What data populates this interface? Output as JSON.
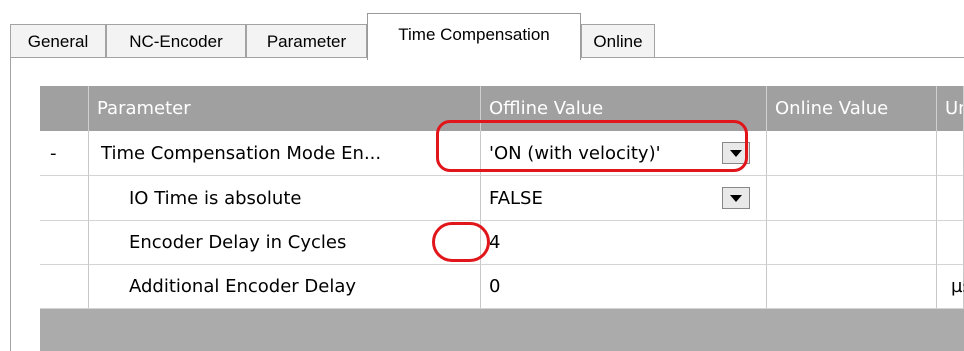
{
  "tabs": [
    {
      "label": "General"
    },
    {
      "label": "NC-Encoder"
    },
    {
      "label": "Parameter"
    },
    {
      "label": "Time Compensation"
    },
    {
      "label": "Online"
    }
  ],
  "active_tab": "Time Compensation",
  "table": {
    "columns": [
      "",
      "Parameter",
      "Offline Value",
      "Online Value",
      "Unit"
    ],
    "rows": [
      {
        "expander": "-",
        "parameter": "Time Compensation Mode En...",
        "offline_value": "'ON (with velocity)'",
        "online_value": "",
        "unit": "",
        "has_dropdown": true
      },
      {
        "expander": "",
        "parameter": "IO Time is absolute",
        "offline_value": "FALSE",
        "online_value": "",
        "unit": "",
        "has_dropdown": true
      },
      {
        "expander": "",
        "parameter": "Encoder Delay in Cycles",
        "offline_value": "4",
        "online_value": "",
        "unit": "",
        "has_dropdown": false
      },
      {
        "expander": "",
        "parameter": "Additional Encoder Delay",
        "offline_value": "0",
        "online_value": "",
        "unit": "µs",
        "has_dropdown": false
      }
    ]
  },
  "highlight_color": "#e0161b"
}
